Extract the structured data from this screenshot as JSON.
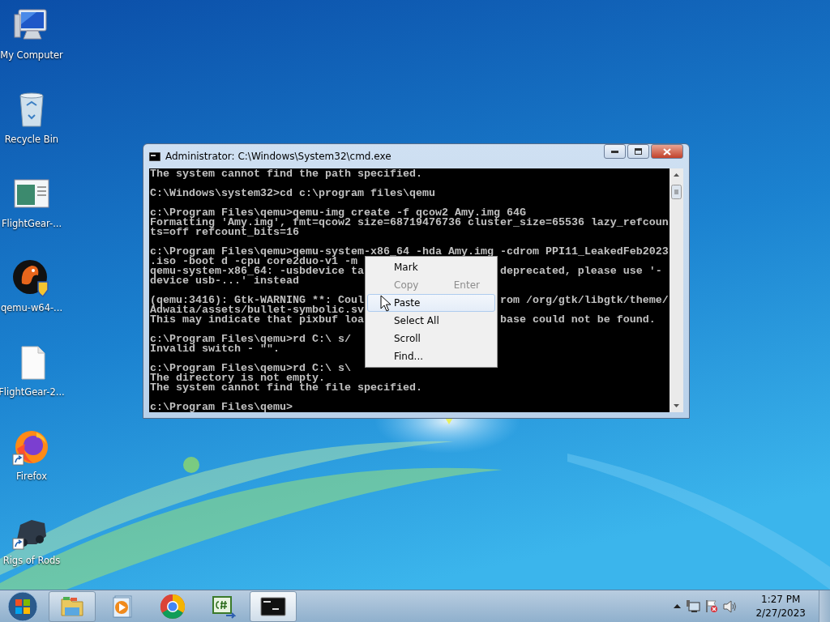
{
  "desktop_icons": [
    {
      "label": "My Computer",
      "kind": "computer",
      "shortcut": false
    },
    {
      "label": "Recycle Bin",
      "kind": "bin",
      "shortcut": false
    },
    {
      "label": "FlightGear-...",
      "kind": "window",
      "shortcut": false
    },
    {
      "label": "qemu-w64-...",
      "kind": "bird",
      "shortcut": false
    },
    {
      "label": "FlightGear-2...",
      "kind": "file",
      "shortcut": false
    },
    {
      "label": "Firefox",
      "kind": "fox",
      "shortcut": true
    },
    {
      "label": "Rigs of Rods",
      "kind": "truck",
      "shortcut": true
    }
  ],
  "window": {
    "title": "Administrator: C:\\Windows\\System32\\cmd.exe",
    "console_blocks": [
      {
        "lines": [
          {
            "text": "The system cannot find the path specified."
          }
        ]
      },
      {
        "lines": [
          {
            "text": "C:\\Windows\\system32>cd c:\\program files\\qemu"
          }
        ]
      },
      {
        "lines": [
          {
            "text": "c:\\Program Files\\qemu>qemu-img create -f qcow2 Amy.img 64G"
          },
          {
            "text": "Formatting 'Amy.img', fmt=qcow2 size=68719476736 cluster_size=65536 lazy_refcoun"
          },
          {
            "text": "ts=off refcount_bits=16"
          }
        ]
      },
      {
        "lines": [
          {
            "text": "c:\\Program Files\\qemu>qemu-system-x86_64 -hda Amy.img -cdrom PPI11_LeakedFeb2023"
          },
          {
            "text": ".iso -boot d -cpu core2duo-v1 -m"
          },
          {
            "text": "qemu-system-x86_64: -usbdevice ta",
            "tail": "deprecated, please use '-"
          },
          {
            "text": "device usb-...' instead"
          }
        ]
      },
      {
        "lines": [
          {
            "text": "(qemu:3416): Gtk-WARNING **: Coul",
            "tail": "rom /org/gtk/libgtk/theme/"
          },
          {
            "text": "Adwaita/assets/bullet-symbolic.sv"
          },
          {
            "text": "This may indicate that pixbuf loa",
            "tail": "base could not be found."
          }
        ]
      },
      {
        "lines": [
          {
            "text": "c:\\Program Files\\qemu>rd C:\\ s/"
          },
          {
            "text": "Invalid switch - \"\"."
          }
        ]
      },
      {
        "lines": [
          {
            "text": "c:\\Program Files\\qemu>rd C:\\ s\\"
          },
          {
            "text": "The directory is not empty."
          },
          {
            "text": "The system cannot find the file specified."
          }
        ]
      },
      {
        "lines": [
          {
            "text": "c:\\Program Files\\qemu>"
          }
        ]
      }
    ]
  },
  "context_menu": {
    "items": [
      {
        "label": "Mark",
        "disabled": false,
        "selected": false
      },
      {
        "label": "Copy",
        "shortcut": "Enter",
        "disabled": true,
        "selected": false
      },
      {
        "label": "Paste",
        "disabled": false,
        "selected": true
      },
      {
        "label": "Select All",
        "disabled": false,
        "selected": false
      },
      {
        "label": "Scroll",
        "disabled": false,
        "selected": false
      },
      {
        "label": "Find...",
        "disabled": false,
        "selected": false
      }
    ]
  },
  "taskbar": {
    "apps": [
      {
        "kind": "explorer",
        "running": true,
        "selected": false
      },
      {
        "kind": "media",
        "running": false,
        "selected": false
      },
      {
        "kind": "chrome",
        "running": false,
        "selected": false
      },
      {
        "kind": "csharp",
        "running": false,
        "selected": false
      },
      {
        "kind": "cmd",
        "running": true,
        "selected": true
      }
    ],
    "clock": {
      "time": "1:27 PM",
      "date": "2/27/2023"
    }
  }
}
